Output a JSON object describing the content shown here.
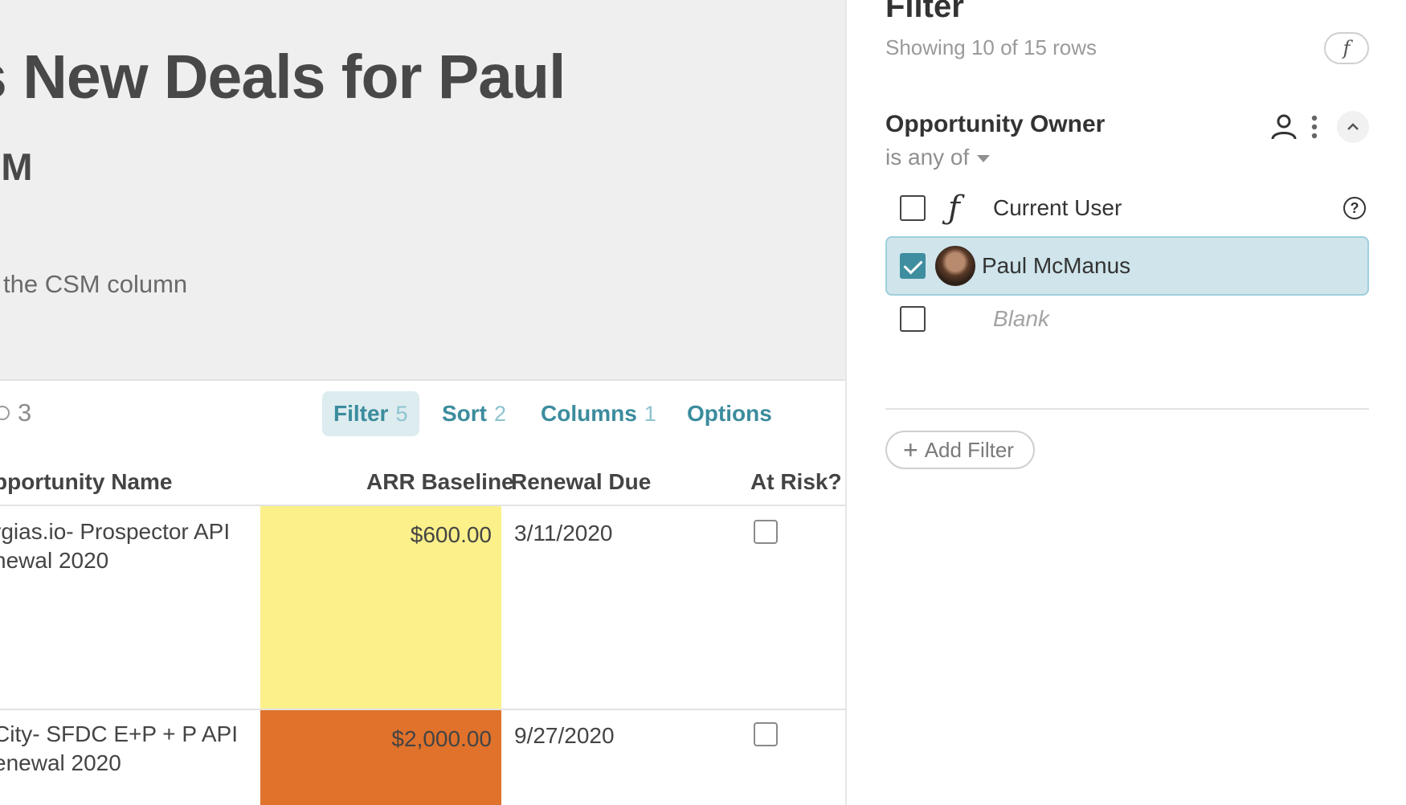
{
  "document": {
    "title": "s New Deals for Paul",
    "subtitle": "SM",
    "description": "the CSM column"
  },
  "toolbar": {
    "comment_count": "3",
    "filter_label": "Filter",
    "filter_count": "5",
    "sort_label": "Sort",
    "sort_count": "2",
    "columns_label": "Columns",
    "columns_count": "1",
    "options_label": "Options"
  },
  "table": {
    "columns": [
      "pportunity Name",
      "ARR Baseline",
      "Renewal Due",
      "At Risk?"
    ],
    "rows": [
      {
        "name_line1": "rgias.io- Prospector API",
        "name_line2": "newal 2020",
        "arr": "$600.00",
        "arr_color": "#fbf08a",
        "renewal_due": "3/11/2020",
        "at_risk": false
      },
      {
        "name_line1": "City- SFDC E+P + P API",
        "name_line2": "enewal 2020",
        "arr": "$2,000.00",
        "arr_color": "#e0722b",
        "renewal_due": "9/27/2020",
        "at_risk": false
      }
    ]
  },
  "filter_panel": {
    "title": "Filter",
    "row_count_text": "Showing 10 of 15 rows",
    "formula_icon": "f",
    "field_name": "Opportunity Owner",
    "operator": "is any of",
    "options": [
      {
        "label": "Current User",
        "checked": false,
        "kind": "formula"
      },
      {
        "label": "Paul McManus",
        "checked": true,
        "kind": "user"
      },
      {
        "label": "Blank",
        "checked": false,
        "kind": "blank"
      }
    ],
    "add_filter_label": "Add Filter",
    "accent_color": "#3e8ea0"
  }
}
